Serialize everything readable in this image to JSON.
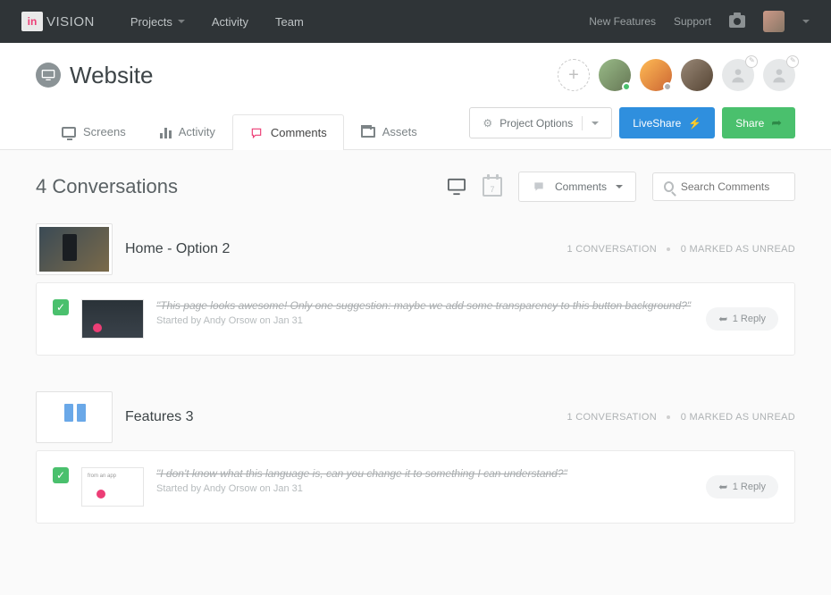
{
  "topnav": {
    "brand_prefix": "in",
    "brand_text": "VISION",
    "projects": "Projects",
    "activity": "Activity",
    "team": "Team",
    "new_features": "New Features",
    "support": "Support"
  },
  "header": {
    "title": "Website",
    "project_options": "Project Options",
    "liveshare": "LiveShare",
    "share": "Share"
  },
  "tabs": {
    "screens": "Screens",
    "activity": "Activity",
    "comments": "Comments",
    "assets": "Assets"
  },
  "toolbar": {
    "title": "4 Conversations",
    "calendar_day": "7",
    "comments_filter": "Comments",
    "search_placeholder": "Search Comments"
  },
  "groups": [
    {
      "title": "Home - Option 2",
      "conversation_count": "1 CONVERSATION",
      "unread": "0 MARKED AS UNREAD",
      "comment_text": "\"This page looks awesome! Only one suggestion: maybe we add some transparency to this button background?\"",
      "meta": "Started by Andy Orsow on Jan 31",
      "reply": "1 Reply"
    },
    {
      "title": "Features 3",
      "conversation_count": "1 CONVERSATION",
      "unread": "0 MARKED AS UNREAD",
      "comment_text": "\"I don't know what this language is, can you change it to something I can understand?\"",
      "meta": "Started by Andy Orsow on Jan 31",
      "reply": "1 Reply"
    }
  ]
}
